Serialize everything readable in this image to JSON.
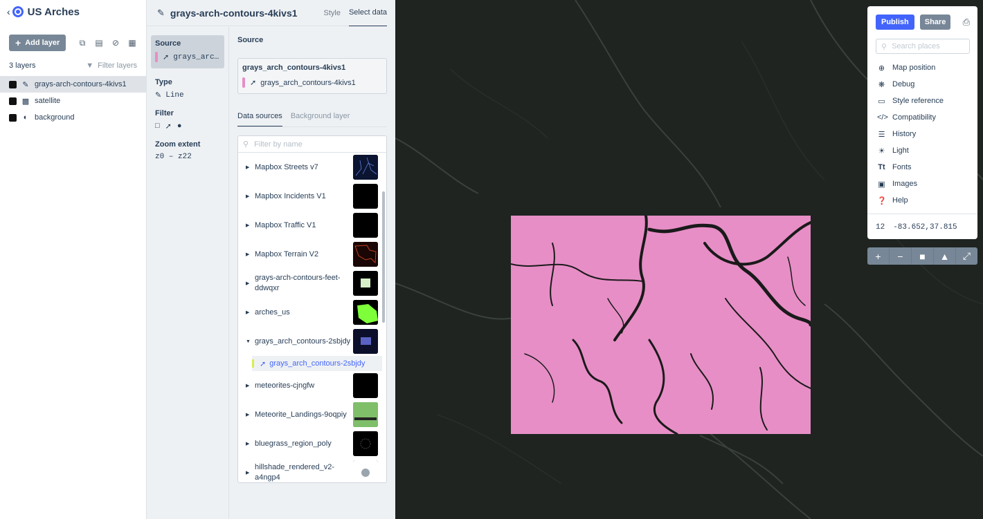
{
  "app": {
    "back_icon": "chevron-left-icon",
    "title": "US Arches"
  },
  "left_toolbar": {
    "add_layer_label": "Add layer",
    "icons": [
      "duplicate-icon",
      "folder-icon",
      "hide-icon",
      "trash-icon"
    ]
  },
  "layers_meta": {
    "count_label": "3 layers",
    "filter_label": "Filter layers"
  },
  "layers": [
    {
      "name": "grays-arch-contours-4kivs1",
      "type_icon": "line-icon",
      "color": "#111111",
      "selected": true
    },
    {
      "name": "satellite",
      "type_icon": "raster-icon",
      "color": "#111111",
      "selected": false
    },
    {
      "name": "background",
      "type_icon": "background-icon",
      "color": "#111111",
      "selected": false
    }
  ],
  "editor": {
    "layer_title": "grays-arch-contours-4kivs1",
    "tab_style": "Style",
    "tab_select_data": "Select data",
    "source_label": "Source",
    "source_value": "grays_arc…",
    "type_label": "Type",
    "type_value": "Line",
    "filter_label": "Filter",
    "zoom_label": "Zoom extent",
    "zoom_value": "z0 – z22"
  },
  "source_panel": {
    "heading": "Source",
    "selected_source_name": "grays_arch_contours-4kivs1",
    "selected_source_layer": "grays_arch_contours-4kivs1",
    "tab_data_sources": "Data sources",
    "tab_background": "Background layer",
    "filter_placeholder": "Filter by name",
    "sources": [
      {
        "name": "Mapbox Streets v7",
        "expanded": false,
        "thumb": "#0b1430"
      },
      {
        "name": "Mapbox Incidents V1",
        "expanded": false,
        "thumb": "#000000"
      },
      {
        "name": "Mapbox Traffic V1",
        "expanded": false,
        "thumb": "#000000"
      },
      {
        "name": "Mapbox Terrain V2",
        "expanded": false,
        "thumb": "#2a0a06"
      },
      {
        "name": "grays-arch-contours-feet-ddwqxr",
        "expanded": false,
        "thumb": "#000000"
      },
      {
        "name": "arches_us",
        "expanded": false,
        "thumb": "#000000"
      },
      {
        "name": "grays_arch_contours-2sbjdy",
        "expanded": true,
        "thumb": "#0b0f2a"
      },
      {
        "name": "meteorites-cjngfw",
        "expanded": false,
        "thumb": "#000000"
      },
      {
        "name": "Meteorite_Landings-9oqpiy",
        "expanded": false,
        "thumb": "#7fbf6a"
      },
      {
        "name": "bluegrass_region_poly",
        "expanded": false,
        "thumb": "#000000"
      },
      {
        "name": "hillshade_rendered_v2-a4ngp4",
        "expanded": false,
        "thumb": "#ffffff"
      }
    ],
    "expanded_child": "grays_arch_contours-2sbjdy"
  },
  "tools": {
    "publish_label": "Publish",
    "share_label": "Share",
    "print_icon": "print-icon",
    "search_placeholder": "Search places",
    "menu": [
      {
        "label": "Map position",
        "icon": "crosshair-icon"
      },
      {
        "label": "Debug",
        "icon": "bug-icon"
      },
      {
        "label": "Style reference",
        "icon": "book-icon"
      },
      {
        "label": "Compatibility",
        "icon": "code-icon"
      },
      {
        "label": "History",
        "icon": "history-icon"
      },
      {
        "label": "Light",
        "icon": "light-icon"
      },
      {
        "label": "Fonts",
        "icon": "fonts-icon"
      },
      {
        "label": "Images",
        "icon": "image-icon"
      },
      {
        "label": "Help",
        "icon": "help-icon"
      }
    ],
    "zoom_level": "12",
    "coordinates": "-83.652,37.815"
  },
  "map_controls": [
    "zoom-in-icon",
    "zoom-out-icon",
    "lock-icon",
    "compass-icon",
    "fullscreen-icon"
  ],
  "colors": {
    "accent": "#4264fb",
    "layer_color": "#e78ec6",
    "map_bg": "#1f2421"
  }
}
